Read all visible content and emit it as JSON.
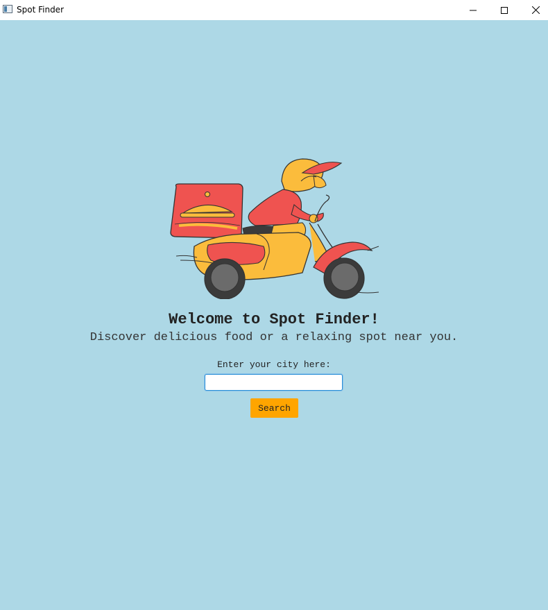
{
  "window": {
    "title": "Spot Finder"
  },
  "main": {
    "illustration": "delivery-scooter-illustration",
    "title": "Welcome to Spot Finder!",
    "subtitle": "Discover delicious food or a relaxing spot near you.",
    "city_label": "Enter your city here:",
    "city_input_value": "",
    "search_label": "Search"
  },
  "colors": {
    "background": "#add8e6",
    "search_button": "#ffa500",
    "input_focus_border": "#2a8fd6",
    "illustration_red": "#ef5350",
    "illustration_yellow": "#fbbc3c",
    "illustration_wheel": "#6b6b6b"
  }
}
